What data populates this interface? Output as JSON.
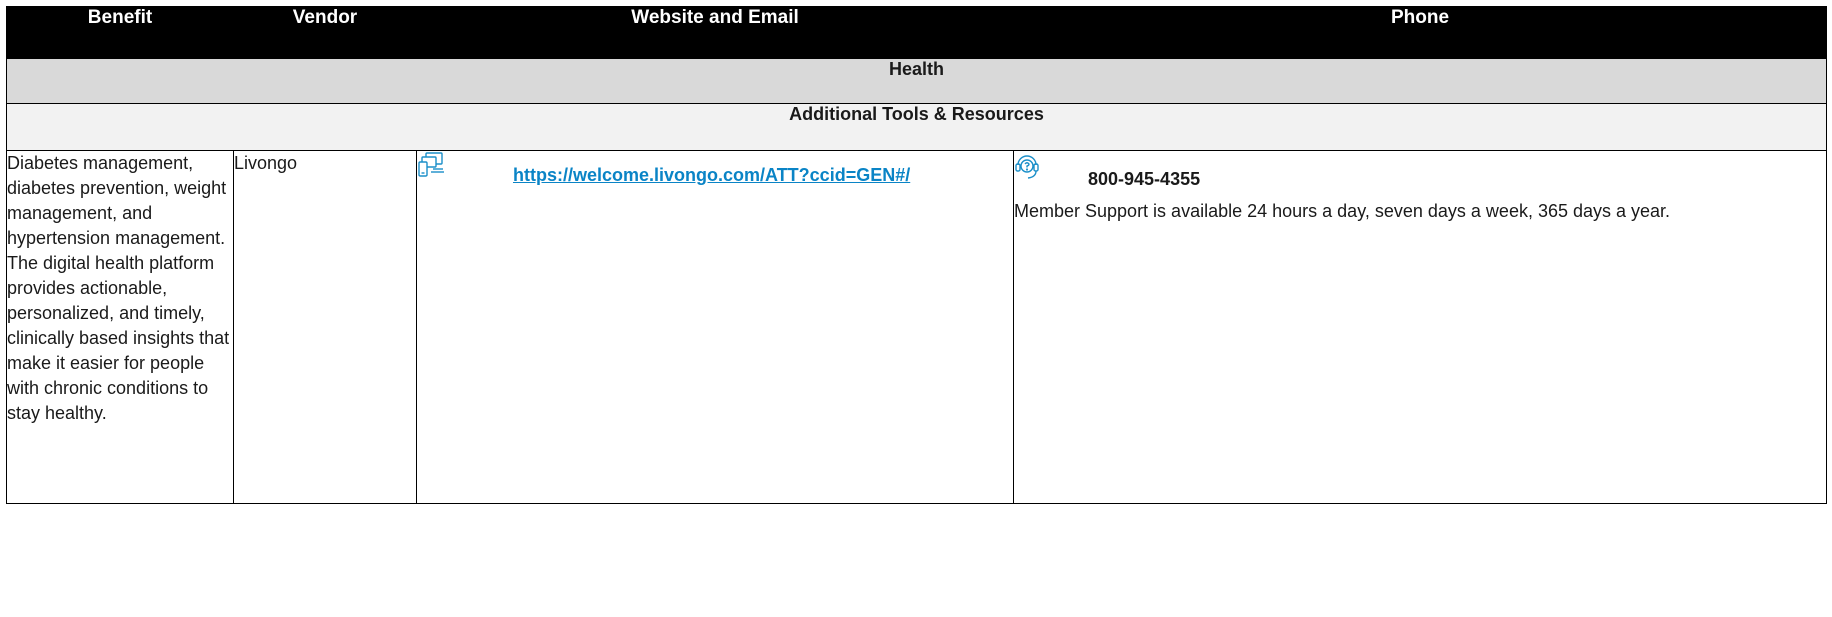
{
  "table": {
    "headers": {
      "benefit": "Benefit",
      "vendor": "Vendor",
      "website": "Website and Email",
      "phone": "Phone"
    },
    "section": "Health",
    "subsection": "Additional Tools & Resources",
    "rows": [
      {
        "benefit": "Diabetes management, diabetes prevention, weight management, and hypertension management. The digital health platform provides actionable, personalized, and timely, clinically based insights that make it easier for people with chronic conditions to stay healthy.",
        "vendor": "Livongo",
        "website_icon": "devices-icon",
        "website": "https://welcome.livongo.com/ATT?ccid=GEN#/",
        "phone_icon": "support-headset-icon",
        "phone": "800-945-4355",
        "phone_note": "Member Support is available 24 hours a day, seven days a week, 365 days a year."
      }
    ]
  },
  "colors": {
    "header_bg": "#000000",
    "header_text": "#ffffff",
    "section_bg": "#d9d9d9",
    "subsection_bg": "#f2f2f2",
    "link": "#0a84c6",
    "icon": "#1b8fc9"
  }
}
